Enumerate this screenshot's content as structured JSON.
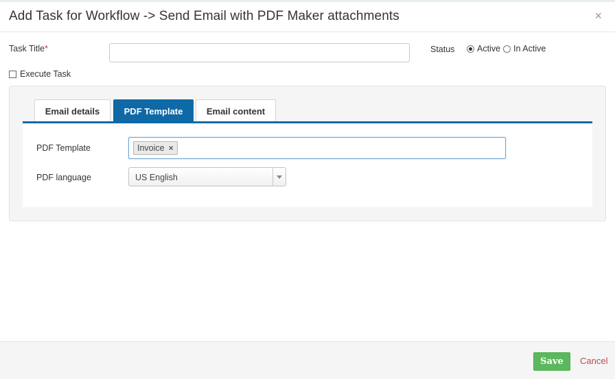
{
  "modal": {
    "title": "Add Task for Workflow -> Send Email with PDF Maker attachments",
    "close_glyph": "×"
  },
  "form": {
    "task_title_label": "Task Title",
    "required_mark": "*",
    "task_title_value": "",
    "status_label": "Status",
    "status_options": [
      "Active",
      "In Active"
    ],
    "status_selected": "Active",
    "execute_task_label": "Execute Task",
    "execute_task_checked": false
  },
  "tabs": [
    {
      "label": "Email details",
      "active": false
    },
    {
      "label": "PDF Template",
      "active": true
    },
    {
      "label": "Email content",
      "active": false
    }
  ],
  "pdf_tab": {
    "pdf_template_label": "PDF Template",
    "pdf_template_tags": [
      "Invoice"
    ],
    "tag_remove_glyph": "×",
    "pdf_language_label": "PDF language",
    "pdf_language_value": "US English"
  },
  "footer": {
    "save_label": "Save",
    "cancel_label": "Cancel"
  },
  "colors": {
    "accent": "#0f69a6",
    "save": "#5cb85c",
    "cancel": "#b94a48",
    "required": "#c0392b"
  },
  "icons": {
    "close": "close-icon",
    "tag_remove": "close-icon",
    "dropdown": "caret-down-icon"
  }
}
